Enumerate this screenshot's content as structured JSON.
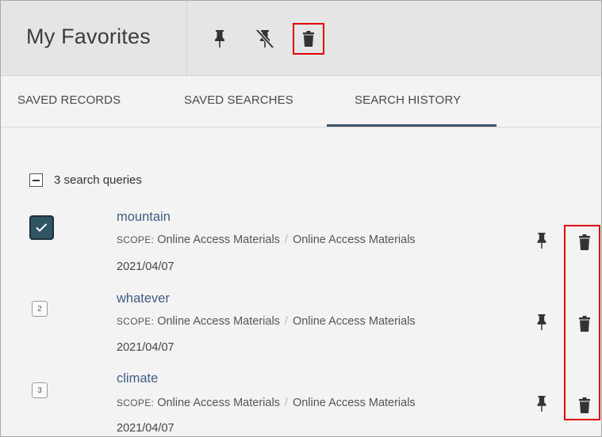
{
  "header": {
    "title": "My Favorites"
  },
  "tabs": [
    {
      "label": "SAVED RECORDS"
    },
    {
      "label": "SAVED SEARCHES"
    },
    {
      "label": "SEARCH HISTORY"
    }
  ],
  "list": {
    "count_label": "3 search queries",
    "queries": [
      {
        "index": "1",
        "title": "mountain",
        "scope_label": "SCOPE:",
        "scope": "Online Access Materials",
        "slash": "/",
        "scope2": "Online Access Materials",
        "date": "2021/04/07",
        "selected": true
      },
      {
        "index": "2",
        "title": "whatever",
        "scope_label": "SCOPE:",
        "scope": "Online Access Materials",
        "slash": "/",
        "scope2": "Online Access Materials",
        "date": "2021/04/07",
        "selected": false
      },
      {
        "index": "3",
        "title": "climate",
        "scope_label": "SCOPE:",
        "scope": "Online Access Materials",
        "slash": "/",
        "scope2": "Online Access Materials",
        "date": "2021/04/07",
        "selected": false
      }
    ]
  },
  "icons": {
    "pin": "pin-icon",
    "unpin": "unpin-icon",
    "delete": "trash-icon"
  },
  "colors": {
    "header_bg": "#e5e5e5",
    "link": "#3f5d84",
    "active_tab_underline": "#3f5369",
    "checkbox_checked": "#2f5563",
    "highlight": "#e00000"
  }
}
